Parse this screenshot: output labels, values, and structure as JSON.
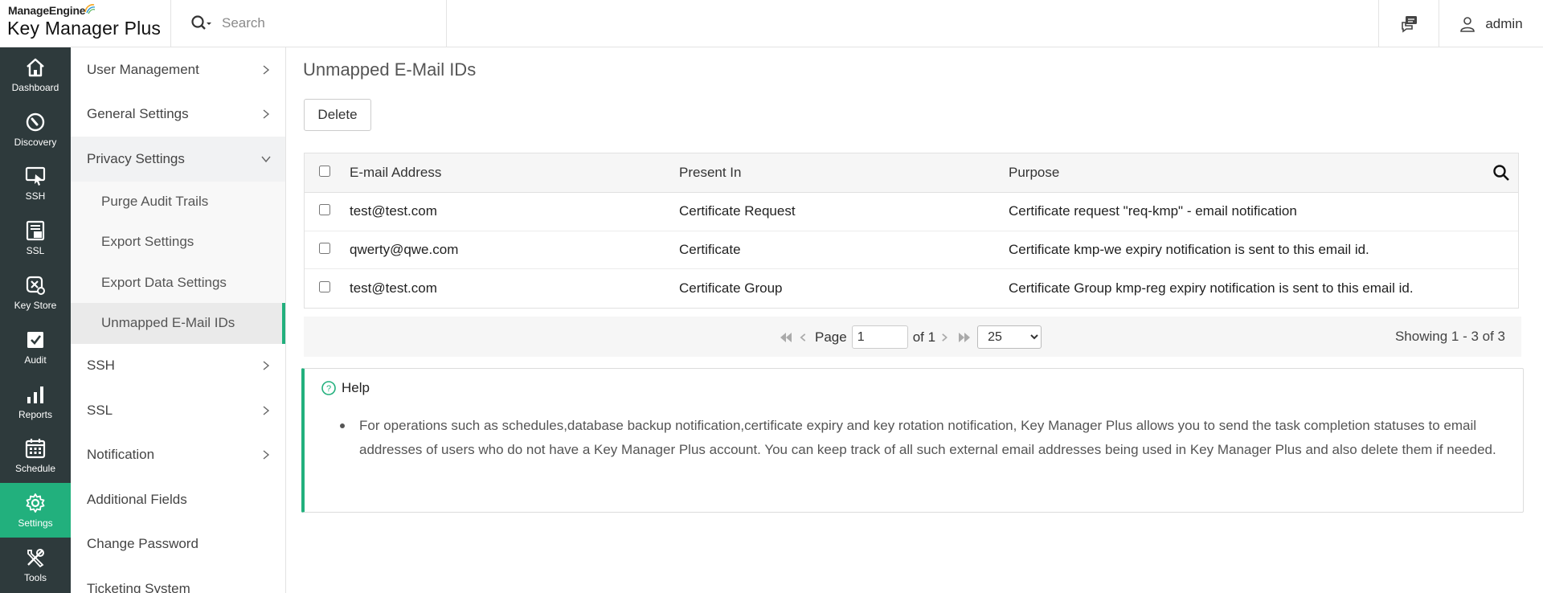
{
  "header": {
    "brand": "ManageEngine",
    "product": "Key Manager Plus",
    "search_placeholder": "Search",
    "user_label": "admin"
  },
  "rail": [
    {
      "label": "Dashboard",
      "icon": "home-icon"
    },
    {
      "label": "Discovery",
      "icon": "discovery-icon"
    },
    {
      "label": "SSH",
      "icon": "ssh-icon"
    },
    {
      "label": "SSL",
      "icon": "ssl-icon"
    },
    {
      "label": "Key Store",
      "icon": "key-store-icon"
    },
    {
      "label": "Audit",
      "icon": "audit-icon"
    },
    {
      "label": "Reports",
      "icon": "reports-icon"
    },
    {
      "label": "Schedule",
      "icon": "calendar-icon"
    },
    {
      "label": "Settings",
      "icon": "gear-icon"
    },
    {
      "label": "Tools",
      "icon": "tools-icon"
    }
  ],
  "menu": {
    "user_management": "User Management",
    "general_settings": "General Settings",
    "privacy_settings": "Privacy Settings",
    "sub": [
      "Purge Audit Trails",
      "Export Settings",
      "Export Data Settings",
      "Unmapped E-Mail IDs"
    ],
    "ssh": "SSH",
    "ssl": "SSL",
    "notification": "Notification",
    "additional_fields": "Additional Fields",
    "change_password": "Change Password",
    "ticketing_system": "Ticketing System"
  },
  "main": {
    "title": "Unmapped E-Mail IDs",
    "delete_label": "Delete",
    "columns": [
      "E-mail Address",
      "Present In",
      "Purpose"
    ],
    "rows": [
      {
        "email": "test@test.com",
        "present_in": "Certificate Request",
        "purpose": "Certificate request \"req-kmp\" - email notification"
      },
      {
        "email": "qwerty@qwe.com",
        "present_in": "Certificate",
        "purpose": "Certificate kmp-we expiry notification is sent to this email id."
      },
      {
        "email": "test@test.com",
        "present_in": "Certificate Group",
        "purpose": "Certificate Group kmp-reg expiry notification is sent to this email id."
      }
    ],
    "pager": {
      "page_label": "Page",
      "page_value": "1",
      "of_label": "of 1",
      "page_size": "25",
      "showing": "Showing 1 - 3 of 3"
    },
    "help": {
      "title": "Help",
      "text": "For operations such as schedules,database backup notification,certificate expiry and key rotation notification, Key Manager Plus allows you to send the task completion statuses to email addresses of users who do not have a Key Manager Plus account. You can keep track of all such external email addresses being used in Key Manager Plus and also delete them if needed."
    }
  },
  "colors": {
    "accent": "#22b07d",
    "rail_bg": "#2e3a3c"
  }
}
